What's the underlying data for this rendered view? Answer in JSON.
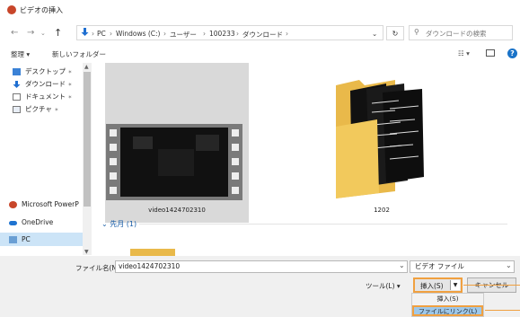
{
  "window": {
    "title": "ビデオの挿入"
  },
  "address": {
    "breadcrumb": [
      "PC",
      "Windows (C:)",
      "ユーザー",
      "100233",
      "ダウンロード"
    ],
    "search_placeholder": "ダウンロードの検索"
  },
  "toolbar": {
    "organize_label": "整理 ▾",
    "new_folder_label": "新しいフォルダー"
  },
  "sidebar": {
    "items": [
      {
        "label": "デスクトップ",
        "icon": "desktop-icon"
      },
      {
        "label": "ダウンロード",
        "icon": "download-icon"
      },
      {
        "label": "ドキュメント",
        "icon": "document-icon"
      },
      {
        "label": "ピクチャ",
        "icon": "pictures-icon"
      },
      {
        "label": "Microsoft PowerP",
        "icon": "powerpoint-icon"
      },
      {
        "label": "OneDrive",
        "icon": "onedrive-icon"
      },
      {
        "label": "PC",
        "icon": "pc-icon"
      }
    ]
  },
  "files": [
    {
      "name": "video1424702310",
      "type": "video"
    },
    {
      "name": "1202",
      "type": "folder"
    }
  ],
  "group": {
    "label": "先月 (1)"
  },
  "bottom": {
    "filename_label": "ファイル名(N):",
    "filename_value": "video1424702310",
    "filetype_value": "ビデオ ファイル",
    "tools_label": "ツール(L)",
    "insert_label": "挿入(S)",
    "cancel_label": "キャンセル"
  },
  "insert_menu": {
    "item1": "挿入(S)",
    "item2": "ファイルにリンク(L)"
  },
  "colors": {
    "accent": "#f0a040",
    "link": "#1a5ea8",
    "selection": "#d9d9d9"
  }
}
